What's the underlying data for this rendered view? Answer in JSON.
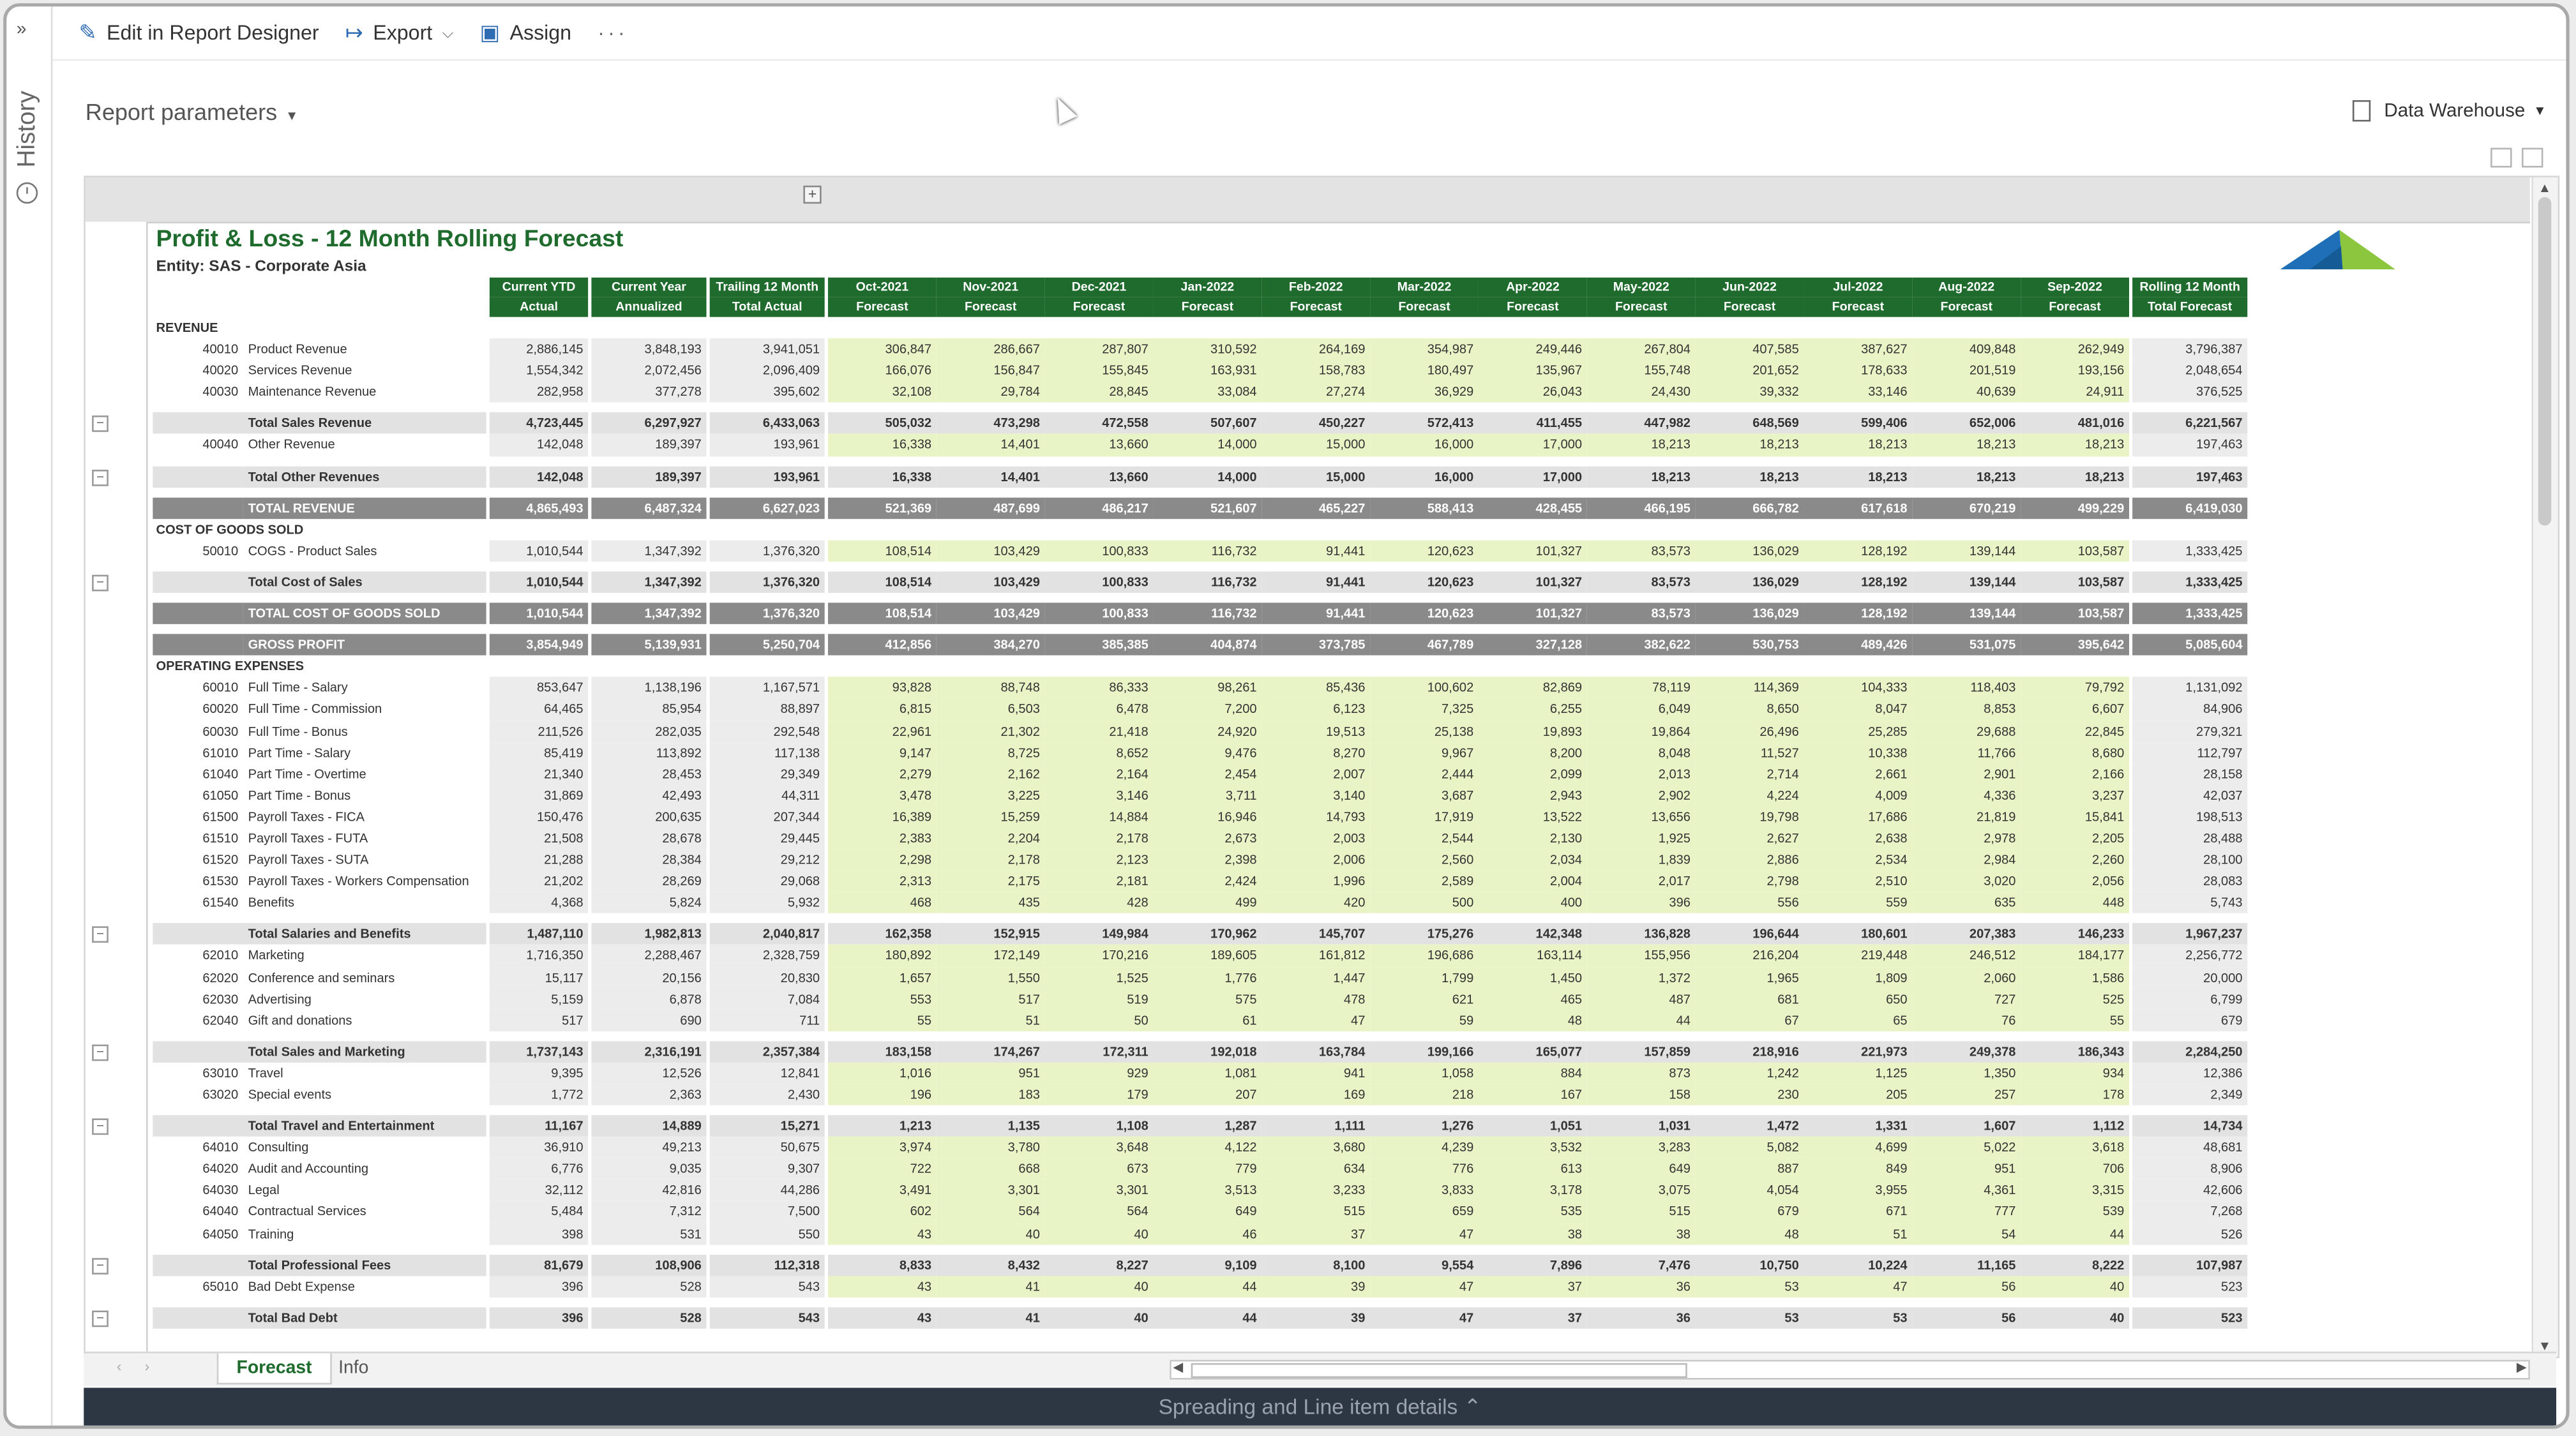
{
  "toolbar": {
    "edit": "Edit in Report Designer",
    "export": "Export",
    "assign": "Assign",
    "more": "···"
  },
  "rail": {
    "label": "History"
  },
  "params": {
    "label": "Report parameters",
    "source": "Data Warehouse"
  },
  "report": {
    "title": "Profit & Loss - 12 Month Rolling Forecast",
    "entity": "Entity: SAS - Corporate Asia",
    "headers": [
      [
        "Current YTD",
        "Actual"
      ],
      [
        "Current Year",
        "Annualized"
      ],
      [
        "Trailing 12 Month",
        "Total Actual"
      ],
      [
        "Oct-2021",
        "Forecast"
      ],
      [
        "Nov-2021",
        "Forecast"
      ],
      [
        "Dec-2021",
        "Forecast"
      ],
      [
        "Jan-2022",
        "Forecast"
      ],
      [
        "Feb-2022",
        "Forecast"
      ],
      [
        "Mar-2022",
        "Forecast"
      ],
      [
        "Apr-2022",
        "Forecast"
      ],
      [
        "May-2022",
        "Forecast"
      ],
      [
        "Jun-2022",
        "Forecast"
      ],
      [
        "Jul-2022",
        "Forecast"
      ],
      [
        "Aug-2022",
        "Forecast"
      ],
      [
        "Sep-2022",
        "Forecast"
      ],
      [
        "Rolling 12 Month",
        "Total Forecast"
      ]
    ],
    "rows": [
      {
        "type": "sec",
        "label": "REVENUE"
      },
      {
        "type": "d",
        "acct": "40010",
        "desc": "Product Revenue",
        "v": [
          "2,886,145",
          "3,848,193",
          "3,941,051",
          "306,847",
          "286,667",
          "287,807",
          "310,592",
          "264,169",
          "354,987",
          "249,446",
          "267,804",
          "407,585",
          "387,627",
          "409,848",
          "262,949",
          "3,796,387"
        ]
      },
      {
        "type": "d",
        "acct": "40020",
        "desc": "Services Revenue",
        "v": [
          "1,554,342",
          "2,072,456",
          "2,096,409",
          "166,076",
          "156,847",
          "155,845",
          "163,931",
          "158,783",
          "180,497",
          "135,967",
          "155,748",
          "201,652",
          "178,633",
          "201,519",
          "193,156",
          "2,048,654"
        ]
      },
      {
        "type": "d",
        "acct": "40030",
        "desc": "Maintenance Revenue",
        "v": [
          "282,958",
          "377,278",
          "395,602",
          "32,108",
          "29,784",
          "28,845",
          "33,084",
          "27,274",
          "36,929",
          "26,043",
          "24,430",
          "39,332",
          "33,146",
          "40,639",
          "24,911",
          "376,525"
        ]
      },
      {
        "type": "blank"
      },
      {
        "type": "s",
        "desc": "Total Sales Revenue",
        "v": [
          "4,723,445",
          "6,297,927",
          "6,433,063",
          "505,032",
          "473,298",
          "472,558",
          "507,607",
          "450,227",
          "572,413",
          "411,455",
          "447,982",
          "648,569",
          "599,406",
          "652,006",
          "481,016",
          "6,221,567"
        ]
      },
      {
        "type": "d",
        "acct": "40040",
        "desc": "Other Revenue",
        "v": [
          "142,048",
          "189,397",
          "193,961",
          "16,338",
          "14,401",
          "13,660",
          "14,000",
          "15,000",
          "16,000",
          "17,000",
          "18,213",
          "18,213",
          "18,213",
          "18,213",
          "18,213",
          "197,463"
        ]
      },
      {
        "type": "blank"
      },
      {
        "type": "s",
        "desc": "Total Other Revenues",
        "v": [
          "142,048",
          "189,397",
          "193,961",
          "16,338",
          "14,401",
          "13,660",
          "14,000",
          "15,000",
          "16,000",
          "17,000",
          "18,213",
          "18,213",
          "18,213",
          "18,213",
          "18,213",
          "197,463"
        ]
      },
      {
        "type": "blank"
      },
      {
        "type": "gt",
        "desc": "TOTAL REVENUE",
        "v": [
          "4,865,493",
          "6,487,324",
          "6,627,023",
          "521,369",
          "487,699",
          "486,217",
          "521,607",
          "465,227",
          "588,413",
          "428,455",
          "466,195",
          "666,782",
          "617,618",
          "670,219",
          "499,229",
          "6,419,030"
        ]
      },
      {
        "type": "sec",
        "label": "COST OF GOODS SOLD"
      },
      {
        "type": "d",
        "acct": "50010",
        "desc": "COGS - Product Sales",
        "v": [
          "1,010,544",
          "1,347,392",
          "1,376,320",
          "108,514",
          "103,429",
          "100,833",
          "116,732",
          "91,441",
          "120,623",
          "101,327",
          "83,573",
          "136,029",
          "128,192",
          "139,144",
          "103,587",
          "1,333,425"
        ]
      },
      {
        "type": "blank"
      },
      {
        "type": "s",
        "desc": "Total Cost of Sales",
        "v": [
          "1,010,544",
          "1,347,392",
          "1,376,320",
          "108,514",
          "103,429",
          "100,833",
          "116,732",
          "91,441",
          "120,623",
          "101,327",
          "83,573",
          "136,029",
          "128,192",
          "139,144",
          "103,587",
          "1,333,425"
        ]
      },
      {
        "type": "blank"
      },
      {
        "type": "gt",
        "desc": "TOTAL COST OF GOODS SOLD",
        "v": [
          "1,010,544",
          "1,347,392",
          "1,376,320",
          "108,514",
          "103,429",
          "100,833",
          "116,732",
          "91,441",
          "120,623",
          "101,327",
          "83,573",
          "136,029",
          "128,192",
          "139,144",
          "103,587",
          "1,333,425"
        ]
      },
      {
        "type": "blank"
      },
      {
        "type": "gt",
        "desc": "GROSS PROFIT",
        "v": [
          "3,854,949",
          "5,139,931",
          "5,250,704",
          "412,856",
          "384,270",
          "385,385",
          "404,874",
          "373,785",
          "467,789",
          "327,128",
          "382,622",
          "530,753",
          "489,426",
          "531,075",
          "395,642",
          "5,085,604"
        ]
      },
      {
        "type": "sec",
        "label": "OPERATING EXPENSES"
      },
      {
        "type": "d",
        "acct": "60010",
        "desc": "Full Time - Salary",
        "v": [
          "853,647",
          "1,138,196",
          "1,167,571",
          "93,828",
          "88,748",
          "86,333",
          "98,261",
          "85,436",
          "100,602",
          "82,869",
          "78,119",
          "114,369",
          "104,333",
          "118,403",
          "79,792",
          "1,131,092"
        ]
      },
      {
        "type": "d",
        "acct": "60020",
        "desc": "Full Time - Commission",
        "v": [
          "64,465",
          "85,954",
          "88,897",
          "6,815",
          "6,503",
          "6,478",
          "7,200",
          "6,123",
          "7,325",
          "6,255",
          "6,049",
          "8,650",
          "8,047",
          "8,853",
          "6,607",
          "84,906"
        ]
      },
      {
        "type": "d",
        "acct": "60030",
        "desc": "Full Time - Bonus",
        "v": [
          "211,526",
          "282,035",
          "292,548",
          "22,961",
          "21,302",
          "21,418",
          "24,920",
          "19,513",
          "25,138",
          "19,893",
          "19,864",
          "26,496",
          "25,285",
          "29,688",
          "22,845",
          "279,321"
        ]
      },
      {
        "type": "d",
        "acct": "61010",
        "desc": "Part Time - Salary",
        "v": [
          "85,419",
          "113,892",
          "117,138",
          "9,147",
          "8,725",
          "8,652",
          "9,476",
          "8,270",
          "9,967",
          "8,200",
          "8,048",
          "11,527",
          "10,338",
          "11,766",
          "8,680",
          "112,797"
        ]
      },
      {
        "type": "d",
        "acct": "61040",
        "desc": "Part Time - Overtime",
        "v": [
          "21,340",
          "28,453",
          "29,349",
          "2,279",
          "2,162",
          "2,164",
          "2,454",
          "2,007",
          "2,444",
          "2,099",
          "2,013",
          "2,714",
          "2,661",
          "2,901",
          "2,166",
          "28,158"
        ]
      },
      {
        "type": "d",
        "acct": "61050",
        "desc": "Part Time - Bonus",
        "v": [
          "31,869",
          "42,493",
          "44,311",
          "3,478",
          "3,225",
          "3,146",
          "3,711",
          "3,140",
          "3,687",
          "2,943",
          "2,902",
          "4,224",
          "4,009",
          "4,336",
          "3,237",
          "42,037"
        ]
      },
      {
        "type": "d",
        "acct": "61500",
        "desc": "Payroll Taxes - FICA",
        "v": [
          "150,476",
          "200,635",
          "207,344",
          "16,389",
          "15,259",
          "14,884",
          "16,946",
          "14,793",
          "17,919",
          "13,522",
          "13,656",
          "19,798",
          "17,686",
          "21,819",
          "15,841",
          "198,513"
        ]
      },
      {
        "type": "d",
        "acct": "61510",
        "desc": "Payroll Taxes - FUTA",
        "v": [
          "21,508",
          "28,678",
          "29,445",
          "2,383",
          "2,204",
          "2,178",
          "2,673",
          "2,003",
          "2,544",
          "2,130",
          "1,925",
          "2,627",
          "2,638",
          "2,978",
          "2,205",
          "28,488"
        ]
      },
      {
        "type": "d",
        "acct": "61520",
        "desc": "Payroll Taxes - SUTA",
        "v": [
          "21,288",
          "28,384",
          "29,212",
          "2,298",
          "2,178",
          "2,123",
          "2,398",
          "2,006",
          "2,560",
          "2,034",
          "1,839",
          "2,886",
          "2,534",
          "2,984",
          "2,260",
          "28,100"
        ]
      },
      {
        "type": "d",
        "acct": "61530",
        "desc": "Payroll Taxes - Workers Compensation",
        "v": [
          "21,202",
          "28,269",
          "29,068",
          "2,313",
          "2,175",
          "2,181",
          "2,424",
          "1,996",
          "2,589",
          "2,004",
          "2,017",
          "2,798",
          "2,510",
          "3,020",
          "2,056",
          "28,083"
        ]
      },
      {
        "type": "d",
        "acct": "61540",
        "desc": "Benefits",
        "v": [
          "4,368",
          "5,824",
          "5,932",
          "468",
          "435",
          "428",
          "499",
          "420",
          "500",
          "400",
          "396",
          "556",
          "559",
          "635",
          "448",
          "5,743"
        ]
      },
      {
        "type": "blank"
      },
      {
        "type": "s",
        "desc": "Total Salaries and Benefits",
        "v": [
          "1,487,110",
          "1,982,813",
          "2,040,817",
          "162,358",
          "152,915",
          "149,984",
          "170,962",
          "145,707",
          "175,276",
          "142,348",
          "136,828",
          "196,644",
          "180,601",
          "207,383",
          "146,233",
          "1,967,237"
        ]
      },
      {
        "type": "d",
        "acct": "62010",
        "desc": "Marketing",
        "v": [
          "1,716,350",
          "2,288,467",
          "2,328,759",
          "180,892",
          "172,149",
          "170,216",
          "189,605",
          "161,812",
          "196,686",
          "163,114",
          "155,956",
          "216,204",
          "219,448",
          "246,512",
          "184,177",
          "2,256,772"
        ]
      },
      {
        "type": "d",
        "acct": "62020",
        "desc": "Conference and seminars",
        "v": [
          "15,117",
          "20,156",
          "20,830",
          "1,657",
          "1,550",
          "1,525",
          "1,776",
          "1,447",
          "1,799",
          "1,450",
          "1,372",
          "1,965",
          "1,809",
          "2,060",
          "1,586",
          "20,000"
        ]
      },
      {
        "type": "d",
        "acct": "62030",
        "desc": "Advertising",
        "v": [
          "5,159",
          "6,878",
          "7,084",
          "553",
          "517",
          "519",
          "575",
          "478",
          "621",
          "465",
          "487",
          "681",
          "650",
          "727",
          "525",
          "6,799"
        ]
      },
      {
        "type": "d",
        "acct": "62040",
        "desc": "Gift and donations",
        "v": [
          "517",
          "690",
          "711",
          "55",
          "51",
          "50",
          "61",
          "47",
          "59",
          "48",
          "44",
          "67",
          "65",
          "76",
          "55",
          "679"
        ]
      },
      {
        "type": "blank"
      },
      {
        "type": "s",
        "desc": "Total Sales and Marketing",
        "v": [
          "1,737,143",
          "2,316,191",
          "2,357,384",
          "183,158",
          "174,267",
          "172,311",
          "192,018",
          "163,784",
          "199,166",
          "165,077",
          "157,859",
          "218,916",
          "221,973",
          "249,378",
          "186,343",
          "2,284,250"
        ]
      },
      {
        "type": "d",
        "acct": "63010",
        "desc": "Travel",
        "v": [
          "9,395",
          "12,526",
          "12,841",
          "1,016",
          "951",
          "929",
          "1,081",
          "941",
          "1,058",
          "884",
          "873",
          "1,242",
          "1,125",
          "1,350",
          "934",
          "12,386"
        ]
      },
      {
        "type": "d",
        "acct": "63020",
        "desc": "Special events",
        "v": [
          "1,772",
          "2,363",
          "2,430",
          "196",
          "183",
          "179",
          "207",
          "169",
          "218",
          "167",
          "158",
          "230",
          "205",
          "257",
          "178",
          "2,349"
        ]
      },
      {
        "type": "blank"
      },
      {
        "type": "s",
        "desc": "Total Travel and Entertainment",
        "v": [
          "11,167",
          "14,889",
          "15,271",
          "1,213",
          "1,135",
          "1,108",
          "1,287",
          "1,111",
          "1,276",
          "1,051",
          "1,031",
          "1,472",
          "1,331",
          "1,607",
          "1,112",
          "14,734"
        ]
      },
      {
        "type": "d",
        "acct": "64010",
        "desc": "Consulting",
        "v": [
          "36,910",
          "49,213",
          "50,675",
          "3,974",
          "3,780",
          "3,648",
          "4,122",
          "3,680",
          "4,239",
          "3,532",
          "3,283",
          "5,082",
          "4,699",
          "5,022",
          "3,618",
          "48,681"
        ]
      },
      {
        "type": "d",
        "acct": "64020",
        "desc": "Audit and Accounting",
        "v": [
          "6,776",
          "9,035",
          "9,307",
          "722",
          "668",
          "673",
          "779",
          "634",
          "776",
          "613",
          "649",
          "887",
          "849",
          "951",
          "706",
          "8,906"
        ]
      },
      {
        "type": "d",
        "acct": "64030",
        "desc": "Legal",
        "v": [
          "32,112",
          "42,816",
          "44,286",
          "3,491",
          "3,301",
          "3,301",
          "3,513",
          "3,233",
          "3,833",
          "3,178",
          "3,075",
          "4,054",
          "3,955",
          "4,361",
          "3,315",
          "42,606"
        ]
      },
      {
        "type": "d",
        "acct": "64040",
        "desc": "Contractual Services",
        "v": [
          "5,484",
          "7,312",
          "7,500",
          "602",
          "564",
          "564",
          "649",
          "515",
          "659",
          "535",
          "515",
          "679",
          "671",
          "777",
          "539",
          "7,268"
        ]
      },
      {
        "type": "d",
        "acct": "64050",
        "desc": "Training",
        "v": [
          "398",
          "531",
          "550",
          "43",
          "40",
          "40",
          "46",
          "37",
          "47",
          "38",
          "38",
          "48",
          "51",
          "54",
          "44",
          "526"
        ]
      },
      {
        "type": "blank"
      },
      {
        "type": "s",
        "desc": "Total Professional Fees",
        "v": [
          "81,679",
          "108,906",
          "112,318",
          "8,833",
          "8,432",
          "8,227",
          "9,109",
          "8,100",
          "9,554",
          "7,896",
          "7,476",
          "10,750",
          "10,224",
          "11,165",
          "8,222",
          "107,987"
        ]
      },
      {
        "type": "d",
        "acct": "65010",
        "desc": "Bad Debt Expense",
        "v": [
          "396",
          "528",
          "543",
          "43",
          "41",
          "40",
          "44",
          "39",
          "47",
          "37",
          "36",
          "53",
          "47",
          "56",
          "40",
          "523"
        ]
      },
      {
        "type": "blank"
      },
      {
        "type": "s",
        "desc": "Total Bad Debt",
        "v": [
          "396",
          "528",
          "543",
          "43",
          "41",
          "40",
          "44",
          "39",
          "47",
          "37",
          "36",
          "53",
          "53",
          "56",
          "40",
          "523"
        ]
      }
    ]
  },
  "tabs": [
    {
      "label": "Forecast",
      "active": true
    },
    {
      "label": "Info",
      "active": false
    }
  ],
  "bottom": {
    "label": "Spreading and Line item details"
  },
  "colors": {
    "header_green": "#1f6b2e",
    "forecast_fill": "#e9f4c6",
    "total_grey": "#8a8a8a",
    "bottom_bar": "#2c3743"
  }
}
